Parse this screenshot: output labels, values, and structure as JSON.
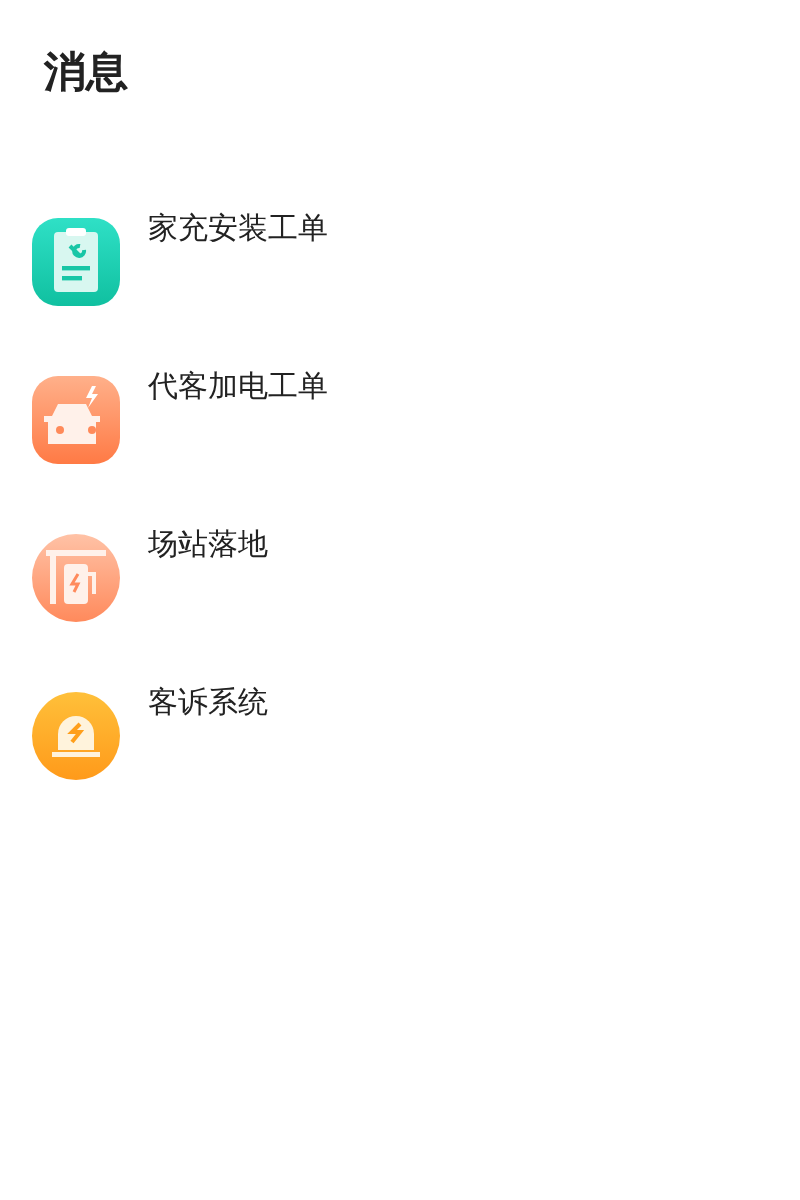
{
  "title": "消息",
  "items": [
    {
      "kind": "clipboard",
      "label": "家充安装工单"
    },
    {
      "kind": "car",
      "label": "代客加电工单"
    },
    {
      "kind": "station",
      "label": "场站落地"
    },
    {
      "kind": "alarm",
      "label": "客诉系统"
    }
  ]
}
